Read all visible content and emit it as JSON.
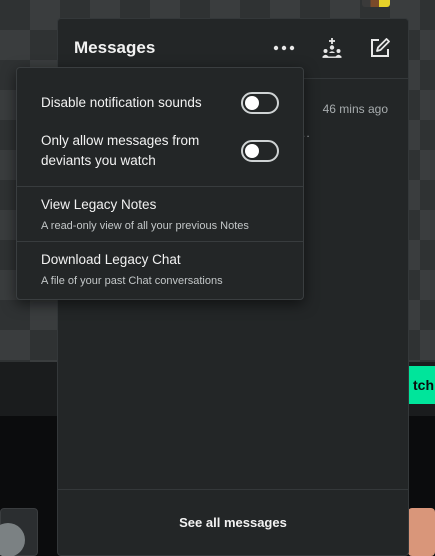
{
  "panel": {
    "title": "Messages",
    "more_icon": "more-horizontal-icon",
    "group_icon": "group-add-icon",
    "compose_icon": "compose-icon",
    "message_time": "46 mins ago",
    "message_preview_dots": "..",
    "footer_link": "See all messages"
  },
  "settings_menu": {
    "toggles": [
      {
        "label": "Disable notification sounds",
        "on": false
      },
      {
        "label_line1": "Only allow messages from",
        "label_line2": "deviants you watch",
        "on": false
      }
    ],
    "links": [
      {
        "title": "View Legacy Notes",
        "subtitle": "A read-only view of all your previous Notes"
      },
      {
        "title": "Download Legacy Chat",
        "subtitle": "A file of your past Chat conversations"
      }
    ]
  },
  "background": {
    "watch_button_fragment": "tch",
    "accent_color": "#00e59b"
  }
}
